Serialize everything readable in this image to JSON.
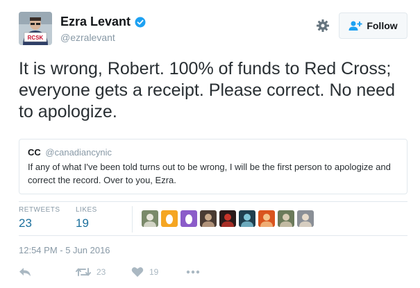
{
  "author": {
    "display_name": "Ezra Levant",
    "handle": "@ezralevant",
    "verified": true,
    "avatar_sign_text": "RCSK"
  },
  "follow_button": {
    "label": "Follow"
  },
  "tweet": {
    "text": "It is wrong, Robert. 100% of funds to Red Cross; everyone gets a receipt. Please correct. No need to apologize."
  },
  "quoted_tweet": {
    "name": "CC",
    "handle": "@canadiancynic",
    "text": "If any of what I've been told turns out to be wrong, I will be the first person to apologize and correct the record. Over to you, Ezra."
  },
  "stats": {
    "retweets_label": "RETWEETS",
    "retweets_count": "23",
    "likes_label": "LIKES",
    "likes_count": "19",
    "liker_avatars": [
      {
        "name": "liker-avatar-1",
        "bg": "#7a8a6a",
        "fg": "#e8e6dc"
      },
      {
        "name": "liker-avatar-2",
        "bg": "#f5a623",
        "fg": "#ffffff"
      },
      {
        "name": "liker-avatar-3",
        "bg": "#8b5cc9",
        "fg": "#ffffff"
      },
      {
        "name": "liker-avatar-4",
        "bg": "#4a3b33",
        "fg": "#c9a98b"
      },
      {
        "name": "liker-avatar-5",
        "bg": "#2a1a1a",
        "fg": "#c8352b"
      },
      {
        "name": "liker-avatar-6",
        "bg": "#1f3f4f",
        "fg": "#7fc6d8"
      },
      {
        "name": "liker-avatar-7",
        "bg": "#d9541e",
        "fg": "#f4c38a"
      },
      {
        "name": "liker-avatar-8",
        "bg": "#6b7a5a",
        "fg": "#d8cbb4"
      },
      {
        "name": "liker-avatar-9",
        "bg": "#8a8f96",
        "fg": "#e8dccb"
      }
    ]
  },
  "timestamp": "12:54 PM - 5 Jun 2016",
  "actions": {
    "retweet_count": "23",
    "like_count": "19"
  },
  "colors": {
    "link": "#1b6f9c",
    "muted": "#8899a6",
    "verified": "#1da1f2",
    "icons": "#aab8c2"
  },
  "icons": [
    "verified-badge-icon",
    "gear-icon",
    "follow-person-plus-icon",
    "reply-icon",
    "retweet-icon",
    "heart-icon",
    "more-icon"
  ]
}
